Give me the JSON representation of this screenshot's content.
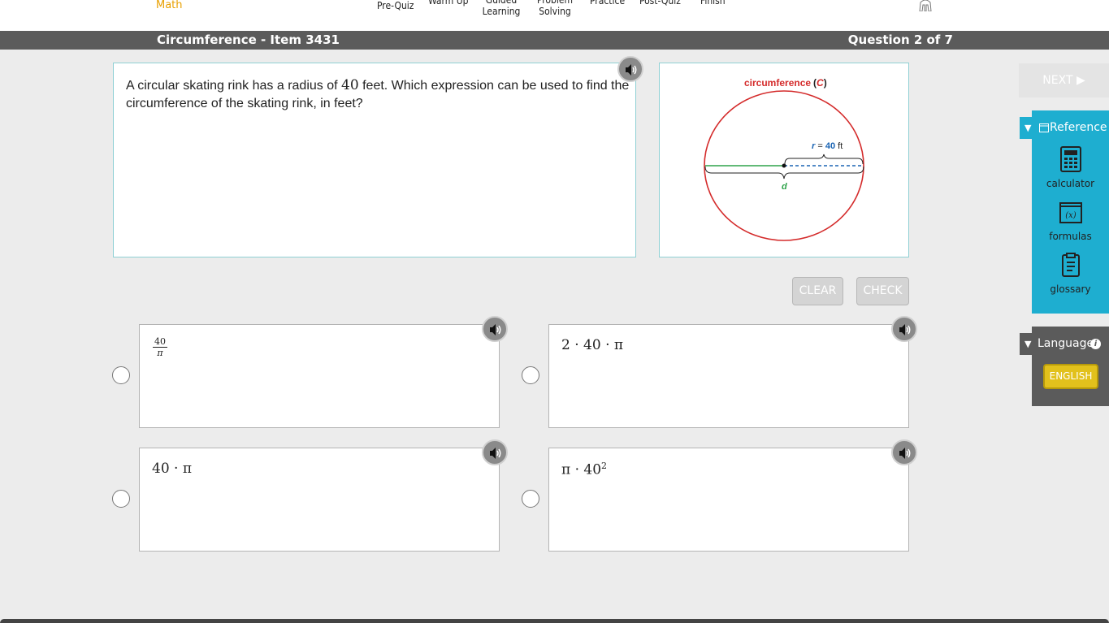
{
  "nav": {
    "brand": "Math",
    "items": [
      {
        "label": "Pre-Quiz"
      },
      {
        "label": "Warm Up"
      },
      {
        "label": "Guided\nLearning"
      },
      {
        "label": "Problem\nSolving"
      },
      {
        "label": "Practice"
      },
      {
        "label": "Post-Quiz"
      },
      {
        "label": "Finish"
      }
    ]
  },
  "titlebar": {
    "title": "Circumference - Item 3431",
    "progress": "Question 2 of 7"
  },
  "question": {
    "text_before": "A circular skating rink has a radius of ",
    "number": "40",
    "text_after": " feet. Which expression can be used to find the circumference of the skating rink, in feet?"
  },
  "figure": {
    "title_word": "circumference",
    "title_open": "(",
    "title_var": "C",
    "title_close": ")",
    "radius_var": "r",
    "radius_eq": " = ",
    "radius_value": "40",
    "radius_unit": " ft",
    "diameter_var": "d"
  },
  "actions": {
    "clear": "CLEAR",
    "check": "CHECK",
    "next": "NEXT ▶"
  },
  "answers": [
    {
      "type": "fraction",
      "numerator": "40",
      "denominator": "π"
    },
    {
      "type": "text",
      "text": "2 · 40 · π"
    },
    {
      "type": "text",
      "text": "40 · π"
    },
    {
      "type": "power",
      "base": "π · 40",
      "exponent": "2"
    }
  ],
  "sidebar": {
    "reference_label": "Reference",
    "tools": [
      {
        "label": "calculator",
        "icon": "calculator-icon"
      },
      {
        "label": "formulas",
        "icon": "formulas-icon"
      },
      {
        "label": "glossary",
        "icon": "glossary-icon"
      }
    ],
    "language_label": "Language",
    "language_button": "ENGLISH"
  },
  "colors": {
    "accent_teal": "#1eaed0",
    "circle_red": "#d42b2b",
    "diameter_green": "#2ea34a",
    "radius_blue": "#1a64b4",
    "brand_orange": "#e8a000",
    "language_yellow": "#e2c11c"
  }
}
